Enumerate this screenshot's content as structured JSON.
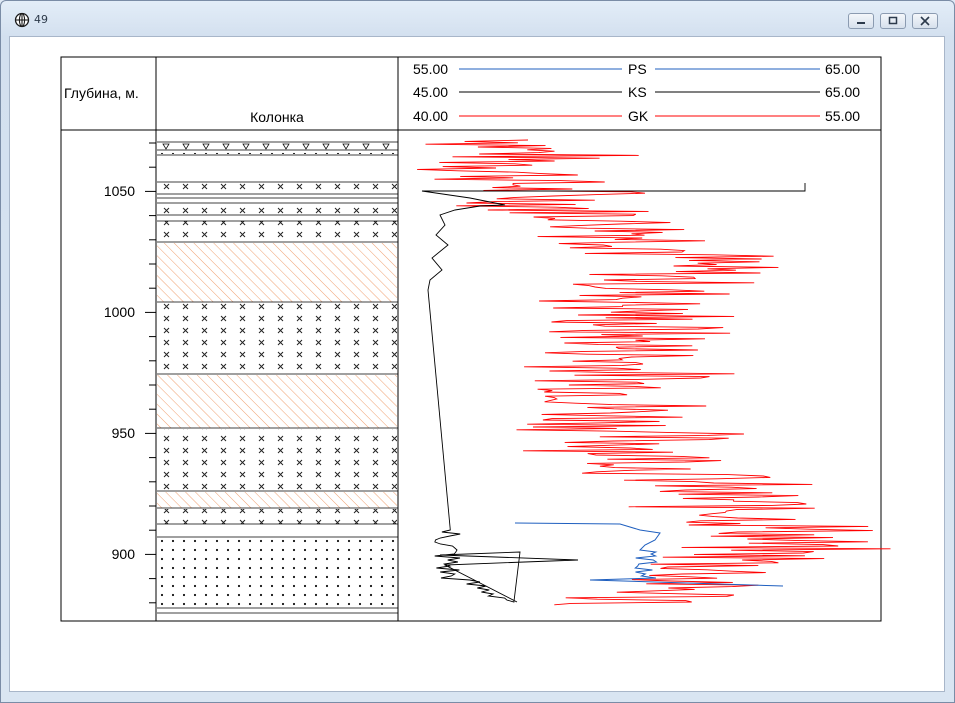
{
  "window": {
    "title": "49",
    "icon": "globe-icon",
    "controls": [
      "minimize-icon",
      "restore-icon",
      "close-icon"
    ]
  },
  "header": {
    "depth_label": "Глубина, м.",
    "column_label": "Колонка"
  },
  "curves": [
    {
      "name": "PS",
      "min": "55.00",
      "max": "65.00",
      "color": "#1f5fbf"
    },
    {
      "name": "KS",
      "min": "45.00",
      "max": "65.00",
      "color": "#000000"
    },
    {
      "name": "GK",
      "min": "40.00",
      "max": "55.00",
      "color": "#ff0000"
    }
  ],
  "depth_ticks": [
    "1050",
    "1000",
    "950",
    "900"
  ],
  "lithology": {
    "layers_top_to_bottom": [
      "triangles",
      "dots",
      "blank",
      "cross",
      "blank",
      "cross",
      "blank",
      "cross",
      "blank",
      "hatch",
      "cross",
      "hatch",
      "cross",
      "hatch",
      "cross",
      "blank",
      "dots"
    ],
    "colors": {
      "hatch": "#f0a070",
      "symbols": "#000000"
    }
  }
}
